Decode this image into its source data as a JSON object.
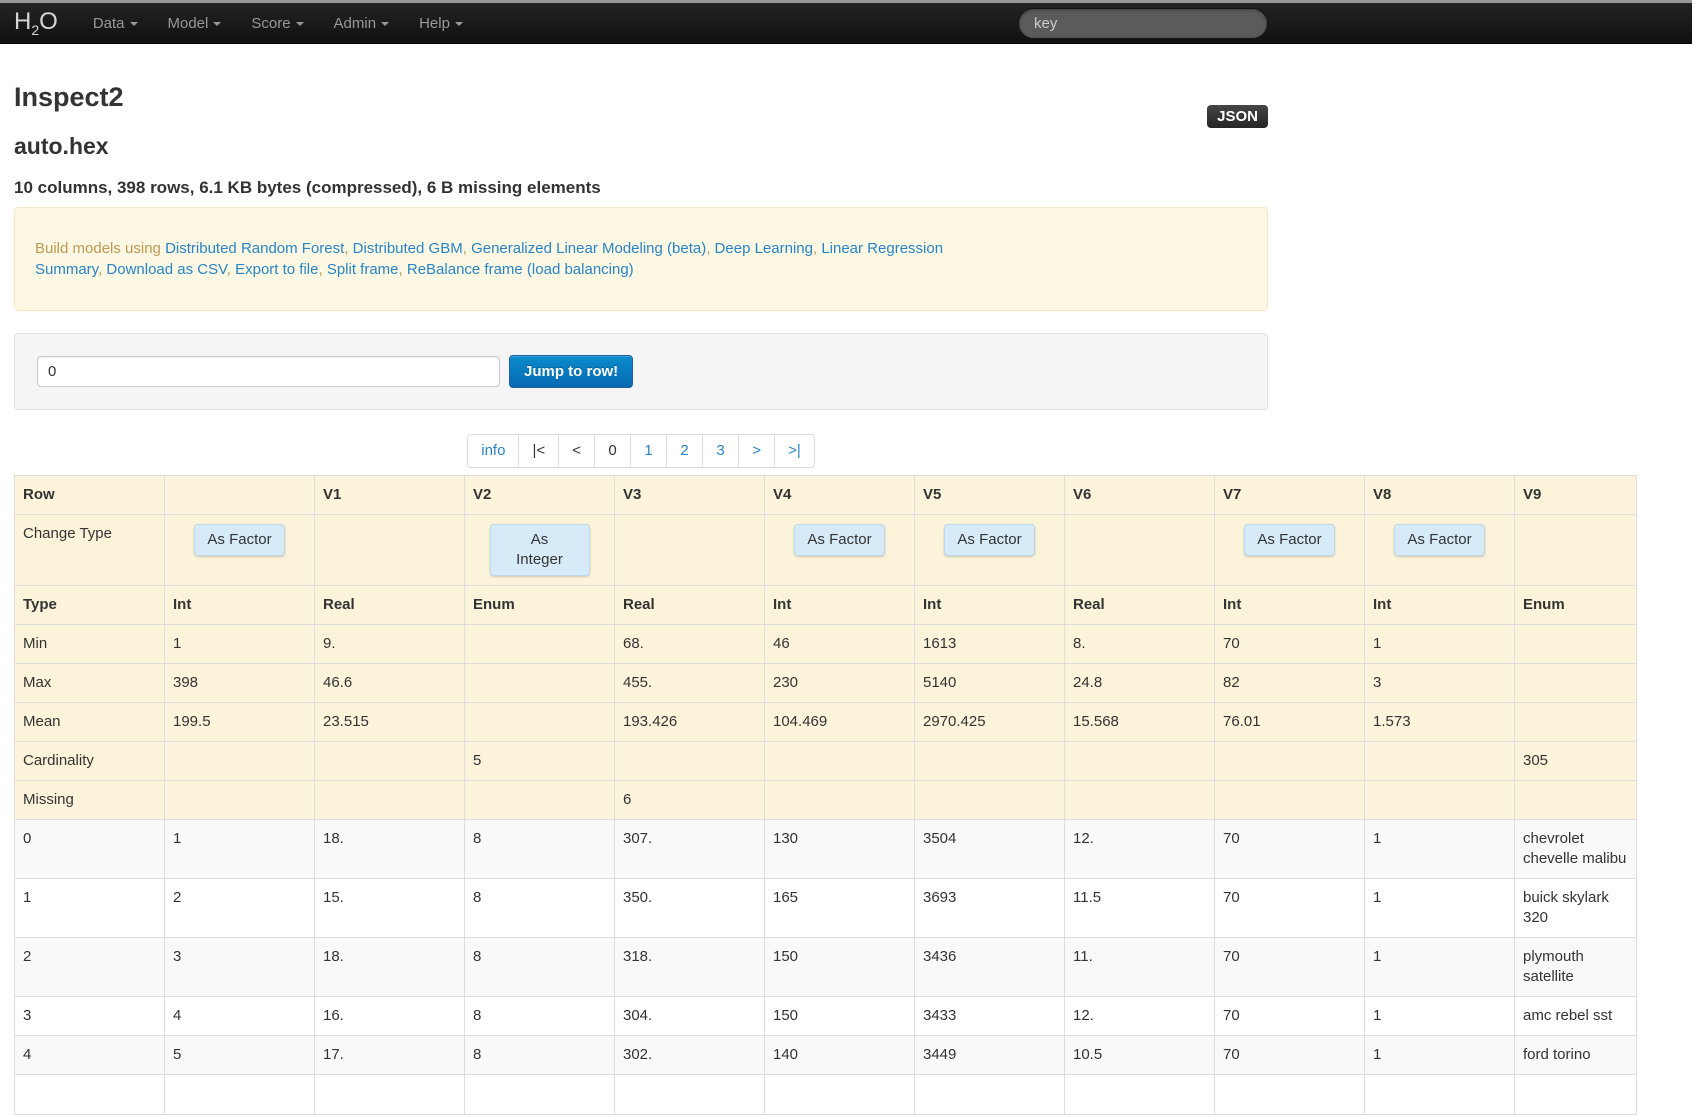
{
  "navbar": {
    "brand": {
      "h": "H",
      "sub": "2",
      "o": "O"
    },
    "items": [
      {
        "label": "Data"
      },
      {
        "label": "Model"
      },
      {
        "label": "Score"
      },
      {
        "label": "Admin"
      },
      {
        "label": "Help"
      }
    ],
    "search_placeholder": "key"
  },
  "page": {
    "title": "Inspect2",
    "json_badge": "JSON",
    "frame_name": "auto.hex",
    "summary": "10 columns, 398 rows, 6.1 KB bytes (compressed), 6 B missing elements"
  },
  "build_bar": {
    "prefix": "Build models using ",
    "separator": ", ",
    "links": [
      {
        "label": "Distributed Random Forest",
        "lines": [
          "Distributed Random Forest"
        ]
      },
      {
        "label": "Distributed GBM",
        "lines": [
          "Distributed GBM"
        ]
      },
      {
        "label": "Generalized Linear Modeling (beta)",
        "lines": [
          "Generalized Linear Modeling (beta)"
        ]
      },
      {
        "label": "Deep Learning",
        "lines": [
          "Deep Learning"
        ]
      },
      {
        "label": "Linear Regression Summary",
        "lines": [
          "Linear Regression",
          "Summary"
        ]
      },
      {
        "label": "Download as CSV",
        "lines": [
          "Download as CSV"
        ]
      },
      {
        "label": "Export to file",
        "lines": [
          "Export to file"
        ]
      },
      {
        "label": "Split frame",
        "lines": [
          "Split frame"
        ]
      },
      {
        "label": "ReBalance frame (load balancing)",
        "lines": [
          "ReBalance frame (load balancing)"
        ]
      }
    ]
  },
  "jump": {
    "input_value": "0",
    "button_label": "Jump to row!"
  },
  "pagination": {
    "items": [
      {
        "label": "info",
        "name": "pagination-info",
        "style": "link"
      },
      {
        "label": "|<",
        "name": "pagination-first",
        "style": "plain"
      },
      {
        "label": "<",
        "name": "pagination-prev",
        "style": "plain"
      },
      {
        "label": "0",
        "name": "pagination-page-0",
        "style": "plain"
      },
      {
        "label": "1",
        "name": "pagination-page-1",
        "style": "link"
      },
      {
        "label": "2",
        "name": "pagination-page-2",
        "style": "link"
      },
      {
        "label": "3",
        "name": "pagination-page-3",
        "style": "link"
      },
      {
        "label": ">",
        "name": "pagination-next",
        "style": "link"
      },
      {
        "label": ">|",
        "name": "pagination-last",
        "style": "link"
      }
    ]
  },
  "table": {
    "columns": [
      "Row",
      "",
      "V1",
      "V2",
      "V3",
      "V4",
      "V5",
      "V6",
      "V7",
      "V8",
      "V9"
    ],
    "change_type": {
      "label": "Change Type",
      "buttons": [
        {
          "label": "As Factor"
        },
        {
          "label": ""
        },
        {
          "label": "As Integer",
          "narrow": true
        },
        {
          "label": ""
        },
        {
          "label": "As Factor"
        },
        {
          "label": "As Factor"
        },
        {
          "label": ""
        },
        {
          "label": "As Factor"
        },
        {
          "label": "As Factor"
        },
        {
          "label": ""
        }
      ]
    },
    "meta_rows": [
      {
        "label": "Type",
        "bold": true,
        "cells": [
          "Int",
          "Real",
          "Enum",
          "Real",
          "Int",
          "Int",
          "Real",
          "Int",
          "Int",
          "Enum"
        ]
      },
      {
        "label": "Min",
        "cells": [
          "1",
          "9.",
          "",
          "68.",
          "46",
          "1613",
          "8.",
          "70",
          "1",
          ""
        ]
      },
      {
        "label": "Max",
        "cells": [
          "398",
          "46.6",
          "",
          "455.",
          "230",
          "5140",
          "24.8",
          "82",
          "3",
          ""
        ]
      },
      {
        "label": "Mean",
        "cells": [
          "199.5",
          "23.515",
          "",
          "193.426",
          "104.469",
          "2970.425",
          "15.568",
          "76.01",
          "1.573",
          ""
        ]
      },
      {
        "label": "Cardinality",
        "cells": [
          "",
          "",
          "5",
          "",
          "",
          "",
          "",
          "",
          "",
          "305"
        ]
      },
      {
        "label": "Missing",
        "cells": [
          "",
          "",
          "",
          "6",
          "",
          "",
          "",
          "",
          "",
          ""
        ]
      }
    ],
    "data_rows": [
      {
        "row": "0",
        "cells": [
          "1",
          "18.",
          "8",
          "307.",
          "130",
          "3504",
          "12.",
          "70",
          "1",
          "chevrolet chevelle malibu"
        ]
      },
      {
        "row": "1",
        "cells": [
          "2",
          "15.",
          "8",
          "350.",
          "165",
          "3693",
          "11.5",
          "70",
          "1",
          "buick skylark 320"
        ]
      },
      {
        "row": "2",
        "cells": [
          "3",
          "18.",
          "8",
          "318.",
          "150",
          "3436",
          "11.",
          "70",
          "1",
          "plymouth satellite"
        ]
      },
      {
        "row": "3",
        "cells": [
          "4",
          "16.",
          "8",
          "304.",
          "150",
          "3433",
          "12.",
          "70",
          "1",
          "amc rebel sst"
        ]
      },
      {
        "row": "4",
        "cells": [
          "5",
          "17.",
          "8",
          "302.",
          "140",
          "3449",
          "10.5",
          "70",
          "1",
          "ford torino"
        ]
      }
    ]
  },
  "colors": {
    "link": "#2b84c6",
    "alert-bg": "#fcf8e3",
    "alert-border": "#f5e8c8",
    "alert-text": "#c09853",
    "cream": "#fbf4da",
    "btn-top": "#0a8ccd",
    "btn-bottom": "#0769b2",
    "btn-border": "#1f5fa0",
    "chg-bg": "#d7eaf8",
    "chg-border": "#bcd9ec",
    "navbar-top": "#242424",
    "navbar-bottom": "#101010"
  }
}
